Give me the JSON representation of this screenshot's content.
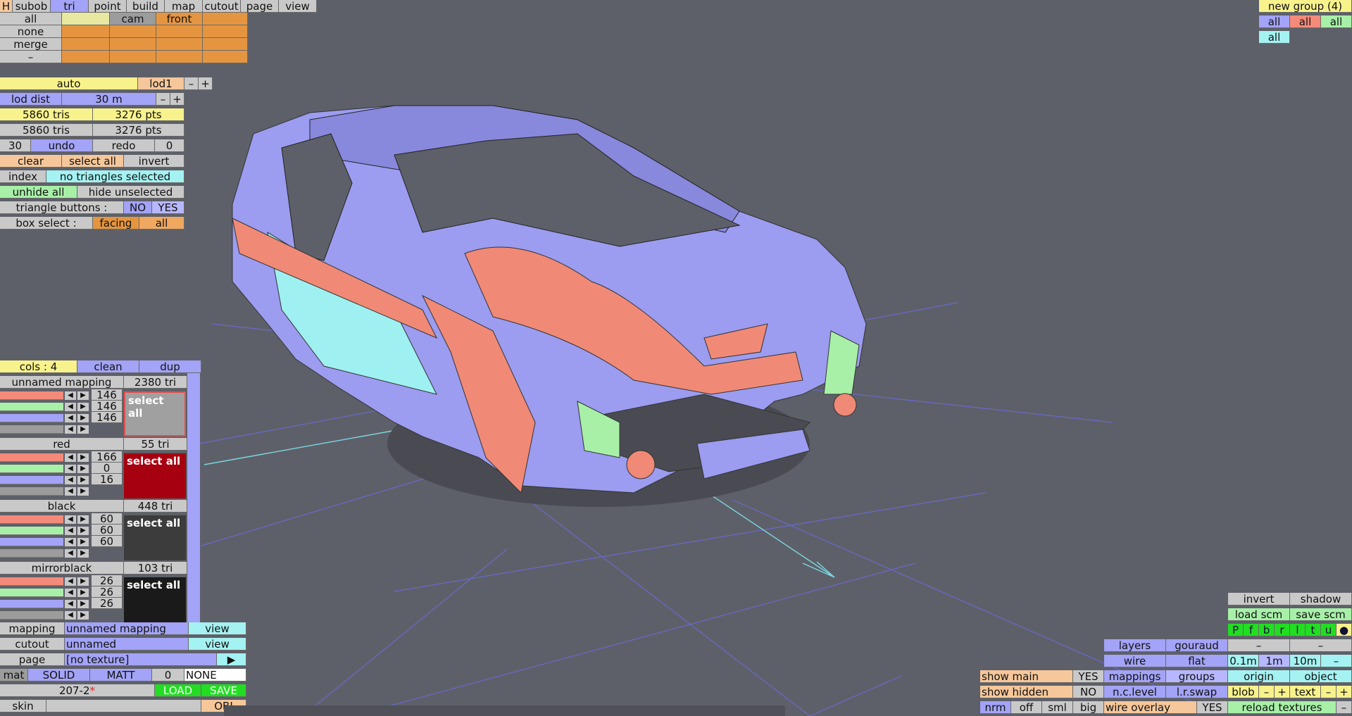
{
  "top_tabs": [
    "H",
    "subob",
    "tri",
    "point",
    "build",
    "map",
    "cutout",
    "page",
    "view"
  ],
  "select_col": [
    "all",
    "none",
    "merge",
    "–"
  ],
  "view_buttons": {
    "cam": "cam",
    "front": "front"
  },
  "lod": {
    "mode": "auto",
    "level": "lod1",
    "minus": "–",
    "plus": "+",
    "dist_label": "lod dist",
    "dist_value": "30 m"
  },
  "stats": {
    "tris1": "5860 tris",
    "pts1": "3276 pts",
    "tris2": "5860 tris",
    "pts2": "3276 pts"
  },
  "undo_row": {
    "count": "30",
    "undo": "undo",
    "redo": "redo",
    "redo_count": "0"
  },
  "sel_row": {
    "clear": "clear",
    "select_all": "select all",
    "invert": "invert"
  },
  "index_row": {
    "index": "index",
    "status": "no triangles selected"
  },
  "hide_row": {
    "unhide": "unhide all",
    "hide": "hide unselected"
  },
  "tri_buttons": {
    "label": "triangle buttons :",
    "no": "NO",
    "yes": "YES"
  },
  "box_select": {
    "label": "box select :",
    "facing": "facing",
    "all": "all"
  },
  "cols_row": {
    "cols": "cols : 4",
    "clean": "clean",
    "dup": "dup"
  },
  "materials": [
    {
      "name": "unnamed mapping",
      "tri": "2380 tri",
      "r": "146",
      "g": "146",
      "b": "146",
      "select": "select all",
      "color": "#a0a0a0"
    },
    {
      "name": "red",
      "tri": "55 tri",
      "r": "166",
      "g": "0",
      "b": "16",
      "select": "select all",
      "color": "#a60010"
    },
    {
      "name": "black",
      "tri": "448 tri",
      "r": "60",
      "g": "60",
      "b": "60",
      "select": "select all",
      "color": "#3c3c3c"
    },
    {
      "name": "mirrorblack",
      "tri": "103 tri",
      "r": "26",
      "g": "26",
      "b": "26",
      "select": "select all",
      "color": "#1a1a1a"
    }
  ],
  "mapping_row": {
    "label": "mapping",
    "value": "unnamed mapping",
    "view": "view"
  },
  "cutout_row": {
    "label": "cutout",
    "value": "unnamed",
    "view": "view"
  },
  "page_row": {
    "label": "page",
    "value": "[no texture]",
    "arrow": "▶"
  },
  "mat_row": {
    "mat": "mat",
    "solid": "SOLID",
    "matt": "MATT",
    "num": "0",
    "none": "NONE"
  },
  "file_row": {
    "name": "207-2",
    "star": "*",
    "load": "LOAD",
    "save": "SAVE"
  },
  "skin_row": {
    "skin": "skin",
    "obj": "OBJ"
  },
  "groups": {
    "title": "new group (4)",
    "all": "all"
  },
  "br": {
    "invert": "invert",
    "shadow": "shadow",
    "load_scm": "load scm",
    "save_scm": "save scm",
    "views": [
      "P",
      "f",
      "b",
      "r",
      "l",
      "t",
      "u",
      "●"
    ],
    "dash": "–",
    "layers": "layers",
    "gouraud": "gouraud",
    "wire": "wire",
    "flat": "flat",
    "d1": "0.1m",
    "d2": "1m",
    "d3": "10m",
    "dminus": "–",
    "show_main": "show main",
    "yes": "YES",
    "mappings": "mappings",
    "groups": "groups",
    "origin": "origin",
    "object": "object",
    "show_hidden": "show hidden",
    "no": "NO",
    "nclevel": "n.c.level",
    "lrswap": "l.r.swap",
    "blob": "blob",
    "minus": "–",
    "plus": "+",
    "text": "text",
    "nrm": "nrm",
    "off": "off",
    "sml": "sml",
    "big": "big",
    "wire_overlay": "wire overlay",
    "reload": "reload textures"
  }
}
